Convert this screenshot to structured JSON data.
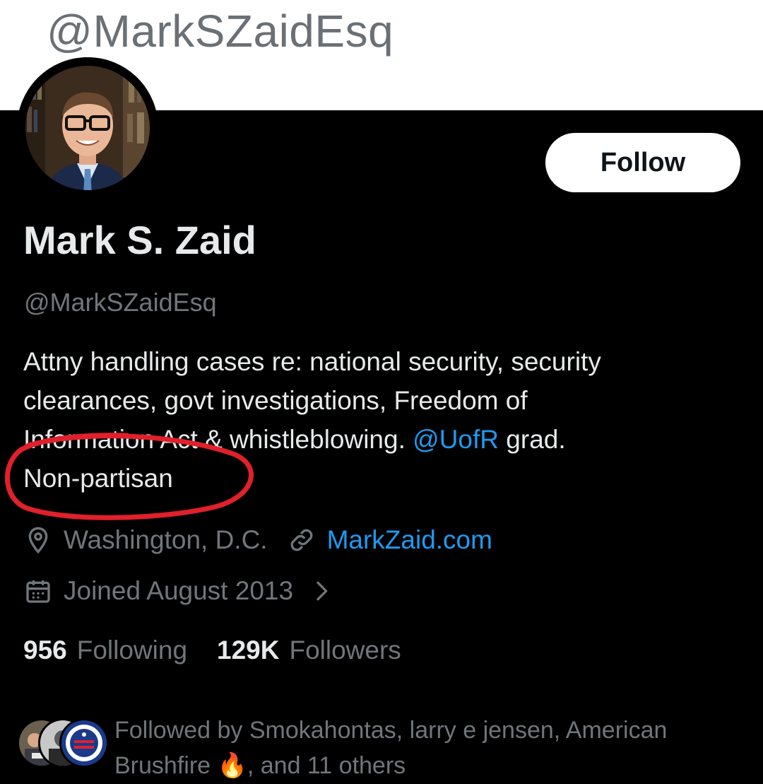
{
  "top_bar": {
    "handle_overlay": "@MarkSZaidEsq"
  },
  "profile": {
    "display_name": "Mark S. Zaid",
    "handle": "@MarkSZaidEsq",
    "follow_label": "Follow",
    "bio_line1": "Attny handling cases re: national security, security",
    "bio_line2": "clearances, govt investigations, Freedom of",
    "bio_line3_start": "Information Act & whistleblowing.",
    "bio_mention": "@UofR",
    "bio_line3_end": "grad.",
    "bio_line4": "Non-partisan",
    "location": "Washington, D.C.",
    "website": "MarkZaid.com",
    "joined": "Joined August 2013",
    "following_count": "956",
    "following_label": "Following",
    "followers_count": "129K",
    "followers_label": "Followers",
    "followed_by_line1": "Followed by Smokahontas, larry e jensen, American",
    "followed_by_line2_start": "Brushfire",
    "followed_by_emoji": "🔥",
    "followed_by_line2_end": ", and 11 others"
  },
  "icons": {
    "location": "location-pin-icon",
    "link": "link-icon",
    "calendar": "calendar-icon",
    "chevron": "chevron-right-icon"
  },
  "colors": {
    "background": "#000000",
    "text_primary": "#e7e9ea",
    "text_secondary": "#71767b",
    "link": "#1d9bf0",
    "annotation": "#e0202a"
  }
}
